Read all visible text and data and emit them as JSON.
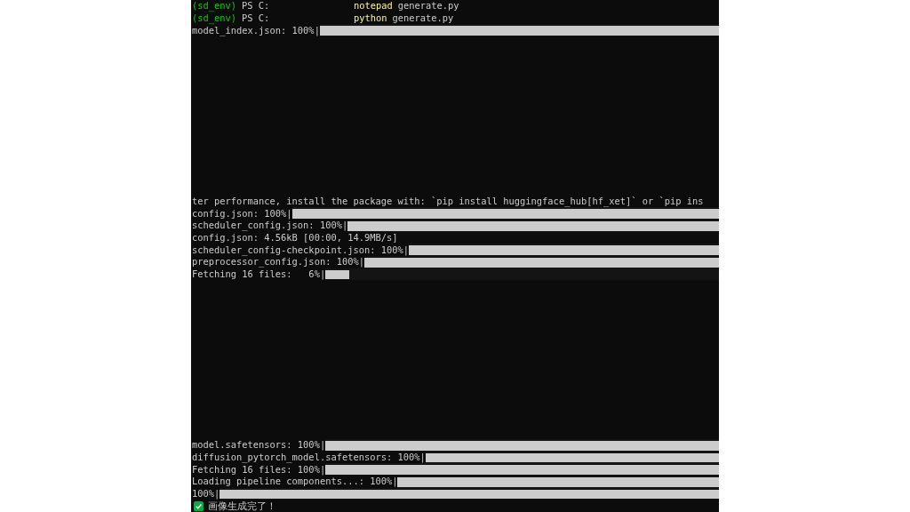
{
  "terminal": {
    "blocks": [
      {
        "lines": [
          {
            "kind": "prompt",
            "env": "(sd_env)",
            "shell": "PS C:",
            "command": "notepad",
            "args": "generate.py"
          },
          {
            "kind": "prompt",
            "env": "(sd_env)",
            "shell": "PS C:",
            "command": "python",
            "args": "generate.py"
          },
          {
            "kind": "progress",
            "label": "model_index.json: 100%|",
            "level": 1
          }
        ]
      },
      {
        "lines": [
          {
            "kind": "text",
            "text": "ter performance, install the package with: `pip install huggingface_hub[hf_xet]` or `pip ins"
          },
          {
            "kind": "progress",
            "label": "config.json: 100%|",
            "level": 1
          },
          {
            "kind": "progress",
            "label": "scheduler_config.json: 100%|",
            "level": 1
          },
          {
            "kind": "text",
            "text": "config.json: 4.56kB [00:00, 14.9MB/s]"
          },
          {
            "kind": "progress",
            "label": "scheduler_config-checkpoint.json: 100%|",
            "level": 1
          },
          {
            "kind": "progress",
            "label": "preprocessor_config.json: 100%|",
            "level": 1
          },
          {
            "kind": "progress",
            "label": "Fetching 16 files:   6%|",
            "level": 0.06
          }
        ]
      },
      {
        "lines": [
          {
            "kind": "progress",
            "label": "model.safetensors: 100%|",
            "level": 1
          },
          {
            "kind": "progress",
            "label": "diffusion_pytorch_model.safetensors: 100%|",
            "level": 1
          },
          {
            "kind": "progress",
            "label": "Fetching 16 files: 100%|",
            "level": 1
          },
          {
            "kind": "progress",
            "label": "Loading pipeline components...: 100%|",
            "level": 1
          },
          {
            "kind": "progress",
            "label": "100%|",
            "level": 1
          },
          {
            "kind": "done",
            "text": "画像生成完了！"
          }
        ]
      }
    ]
  }
}
